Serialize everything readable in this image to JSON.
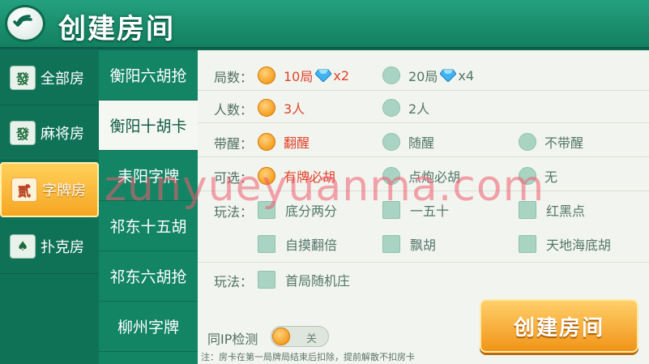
{
  "header": {
    "title": "创建房间"
  },
  "categories": [
    {
      "label": "全部房",
      "icon": "mahjong-fa-icon",
      "glyph": "發",
      "active": false
    },
    {
      "label": "麻将房",
      "icon": "mahjong-fa-icon",
      "glyph": "發",
      "active": false
    },
    {
      "label": "字牌房",
      "icon": "zipai-cards-icon",
      "glyph": "贰",
      "active": true
    },
    {
      "label": "扑克房",
      "icon": "poker-cards-icon",
      "glyph": "♠",
      "active": false
    }
  ],
  "games": [
    {
      "label": "衡阳六胡抢",
      "active": false
    },
    {
      "label": "衡阳十胡卡",
      "active": true
    },
    {
      "label": "耒阳字牌",
      "active": false
    },
    {
      "label": "祁东十五胡",
      "active": false
    },
    {
      "label": "祁东六胡抢",
      "active": false
    },
    {
      "label": "柳州字牌",
      "active": false
    }
  ],
  "options": {
    "rounds": {
      "label": "局数：",
      "choices": [
        {
          "text": "10局",
          "mult": "x2",
          "selected": true
        },
        {
          "text": "20局",
          "mult": "x4",
          "selected": false
        }
      ]
    },
    "players": {
      "label": "人数：",
      "choices": [
        {
          "text": "3人",
          "selected": true
        },
        {
          "text": "2人",
          "selected": false
        }
      ]
    },
    "xing": {
      "label": "带醒：",
      "choices": [
        {
          "text": "翻醒",
          "selected": true
        },
        {
          "text": "随醒",
          "selected": false
        },
        {
          "text": "不带醒",
          "selected": false
        }
      ]
    },
    "optional": {
      "label": "可选：",
      "choices": [
        {
          "text": "有牌必胡",
          "selected": true
        },
        {
          "text": "点炮必胡",
          "selected": false
        },
        {
          "text": "无",
          "selected": false
        }
      ]
    },
    "play1": {
      "label": "玩法：",
      "choices": [
        {
          "text": "底分两分"
        },
        {
          "text": "一五十"
        },
        {
          "text": "红黑点"
        },
        {
          "text": "自摸翻倍"
        },
        {
          "text": "飘胡"
        },
        {
          "text": "天地海底胡"
        }
      ]
    },
    "play2": {
      "label": "玩法：",
      "choices": [
        {
          "text": "首局随机庄"
        }
      ]
    }
  },
  "ip_check": {
    "label": "同IP检测",
    "state_text": "关"
  },
  "note": "注：房卡在第一局牌局结束后扣除，提前解散不扣房卡",
  "create_button": "创建房间",
  "watermark": "zunyueyuanma.com",
  "colors": {
    "accent": "#f19418",
    "header": "#12805f",
    "selected_text": "#e0432a"
  }
}
